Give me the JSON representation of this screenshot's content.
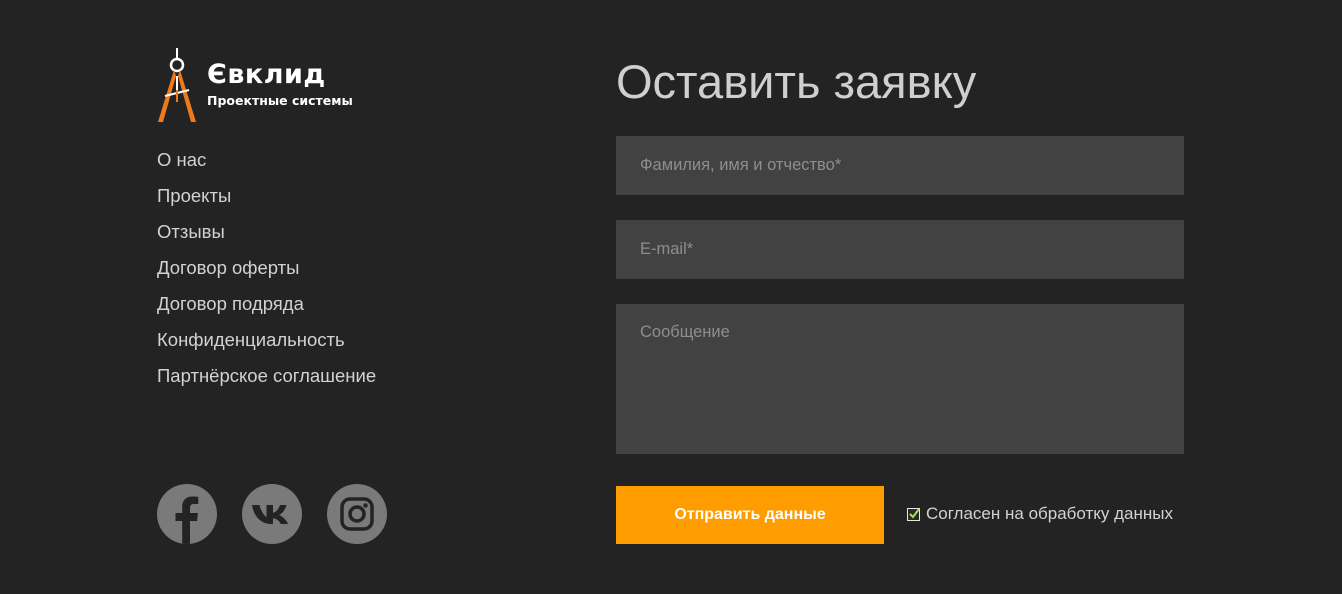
{
  "logo": {
    "title": "Євклид",
    "subtitle": "Проектные системы"
  },
  "nav": {
    "items": [
      "О нас",
      "Проекты",
      "Отзывы",
      "Договор оферты",
      "Договор подряда",
      "Конфиденциальность",
      "Партнёрское соглашение"
    ]
  },
  "socials": [
    "facebook-icon",
    "vk-icon",
    "instagram-icon"
  ],
  "form": {
    "title": "Оставить заявку",
    "name_placeholder": "Фамилия, имя и отчество*",
    "email_placeholder": "E-mail*",
    "message_placeholder": "Сообщение",
    "submit_label": "Отправить данные",
    "consent_label": "Согласен на обработку данных",
    "consent_checked": true
  },
  "colors": {
    "background": "#232323",
    "field": "#424242",
    "accent": "#ff9c00",
    "logo_accent": "#f07a1a",
    "checkmark": "#a6e34a"
  }
}
